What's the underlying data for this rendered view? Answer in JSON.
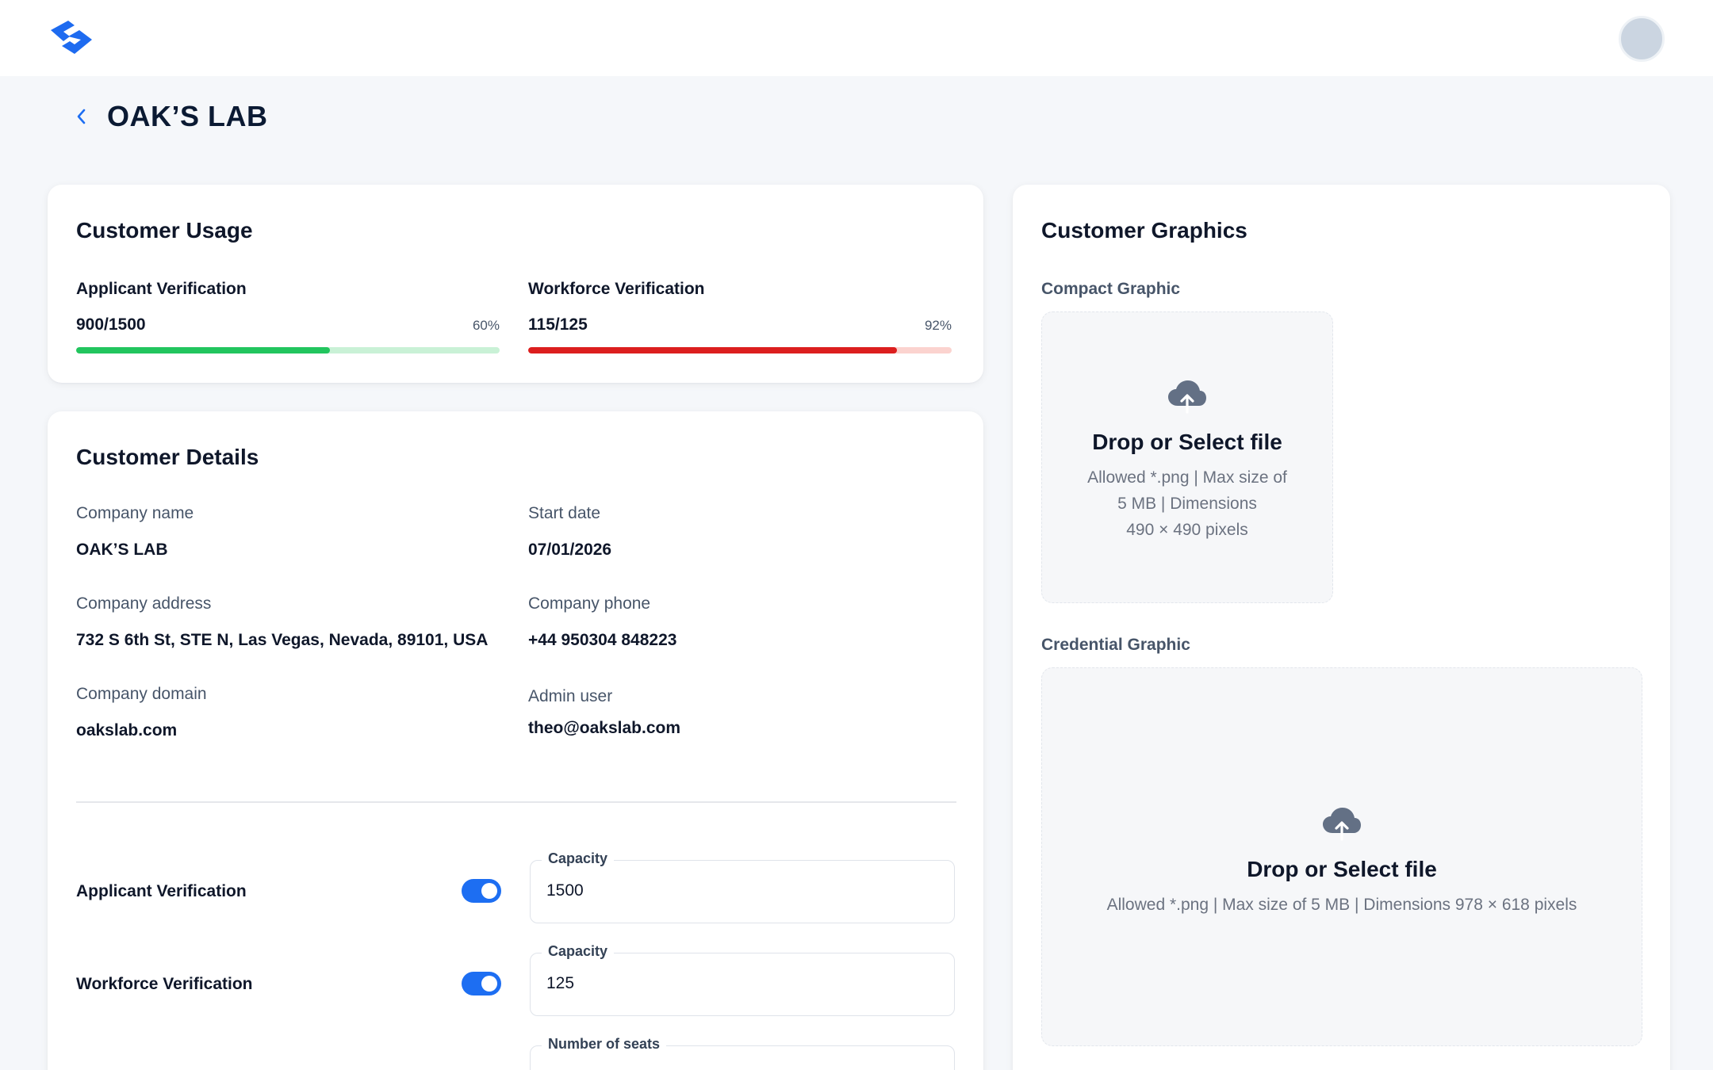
{
  "page": {
    "title": "OAK’S LAB"
  },
  "usage": {
    "title": "Customer Usage",
    "items": [
      {
        "label": "Applicant Verification",
        "value": "900/1500",
        "percent_label": "60%",
        "fraction": 0.6,
        "color": "#22c55e",
        "track_color": "#c9f1d6"
      },
      {
        "label": "Workforce Verification",
        "value": "115/125",
        "percent_label": "92%",
        "fraction": 0.87,
        "color": "#dc1e1e",
        "track_color": "#fbd3cf"
      }
    ]
  },
  "details": {
    "title": "Customer Details",
    "fields": {
      "company_name": {
        "label": "Company name",
        "value": "OAK’S LAB"
      },
      "start_date": {
        "label": "Start date",
        "value": "07/01/2026"
      },
      "company_address": {
        "label": "Company address",
        "value": "732 S 6th St, STE N, Las Vegas, Nevada, 89101, USA"
      },
      "company_phone": {
        "label": "Company phone",
        "value": "+44 950304 848223"
      },
      "company_domain": {
        "label": "Company domain",
        "value": "oakslab.com"
      },
      "admin_user": {
        "label": "Admin user",
        "value": "theo@oakslab.com"
      }
    },
    "toggles": [
      {
        "label": "Applicant Verification",
        "enabled": true,
        "field_label": "Capacity",
        "field_value": "1500"
      },
      {
        "label": "Workforce Verification",
        "enabled": true,
        "field_label": "Capacity",
        "field_value": "125"
      }
    ],
    "seats": {
      "field_label": "Number of seats",
      "field_value": ""
    }
  },
  "graphics": {
    "title": "Customer Graphics",
    "compact": {
      "label": "Compact Graphic",
      "drop_title": "Drop or Select file",
      "hint_line1": "Allowed *.png | Max size of",
      "hint_line2": "5 MB | Dimensions",
      "hint_line3": "490 × 490 pixels"
    },
    "credential": {
      "label": "Credential Graphic",
      "drop_title": "Drop or Select file",
      "hint": "Allowed *.png | Max size of 5 MB | Dimensions 978 × 618 pixels"
    }
  },
  "icons": {
    "logo": "brand-logo-icon",
    "back": "chevron-left-icon",
    "upload": "cloud-upload-icon",
    "avatar": "avatar"
  },
  "colors": {
    "accent": "#1d6ef2",
    "logo": "#1e6bf0"
  }
}
